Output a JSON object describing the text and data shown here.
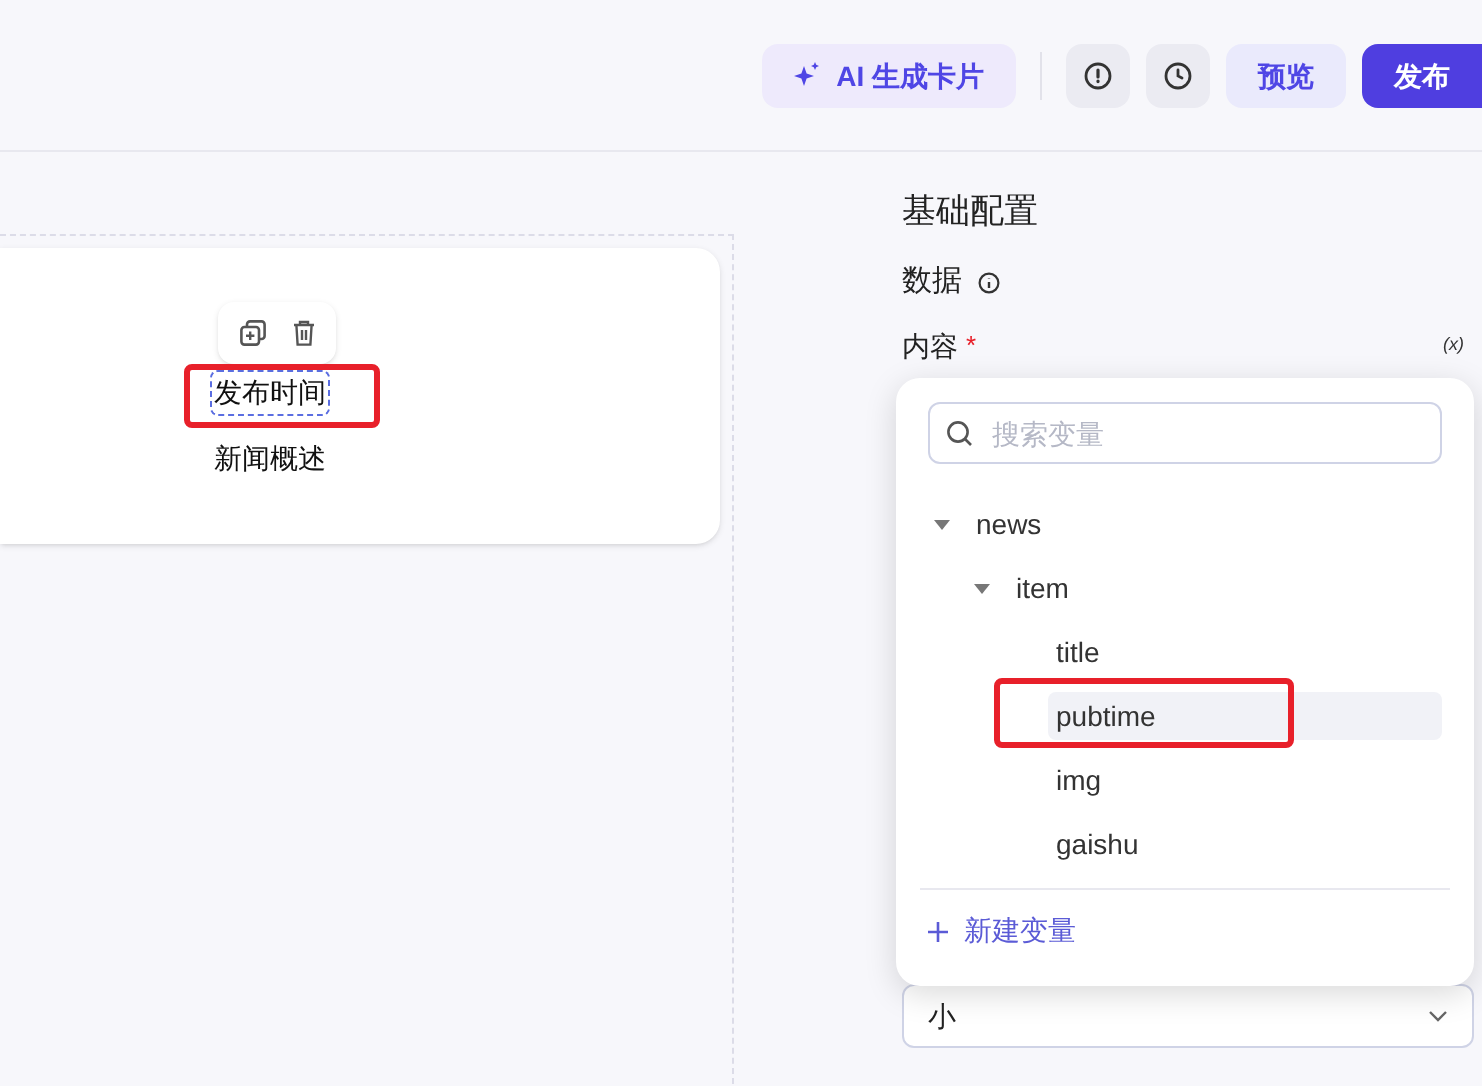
{
  "toolbar": {
    "ai_button": "AI 生成卡片",
    "preview_button": "预览",
    "publish_button": "发布"
  },
  "canvas": {
    "card_lines": [
      {
        "text": "发布时间",
        "selected": true
      },
      {
        "text": "新闻概述",
        "selected": false
      }
    ]
  },
  "panel": {
    "title": "基础配置",
    "section": "数据",
    "field_label": "内容",
    "required_mark": "*",
    "variable_button": "(x)",
    "variable_menu": {
      "search_placeholder": "搜索变量",
      "tree": [
        {
          "label": "news",
          "expanded": true,
          "selected": false,
          "children": [
            {
              "label": "item",
              "expanded": true,
              "selected": false,
              "children": [
                {
                  "label": "title",
                  "selected": false
                },
                {
                  "label": "pubtime",
                  "selected": true
                },
                {
                  "label": "img",
                  "selected": false
                },
                {
                  "label": "gaishu",
                  "selected": false
                }
              ]
            }
          ]
        }
      ],
      "add_button": "新建变量"
    },
    "size_select": {
      "value": "小"
    }
  }
}
